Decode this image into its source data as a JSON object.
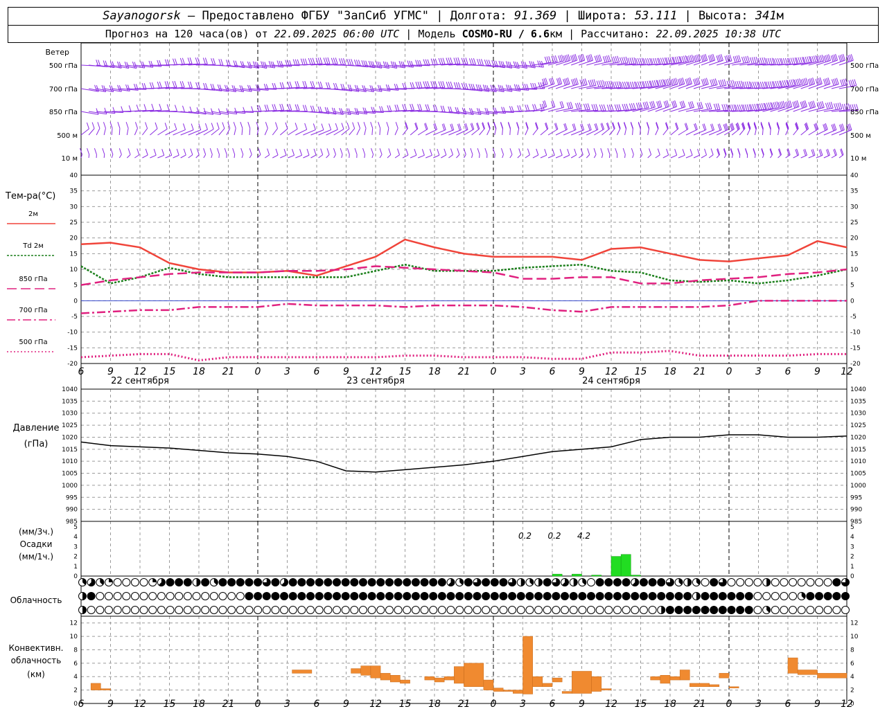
{
  "header": {
    "station": "Sayanogorsk",
    "provider": " – Предоставлено ФГБУ \"ЗапСиб УГМС\" | Долгота: ",
    "longitude": "91.369",
    "lat_label": " | Широта: ",
    "latitude": "53.111",
    "alt_label": " | Высота: ",
    "altitude": "341",
    "alt_unit": "м",
    "forecast_prefix": "Прогноз на 120 часа(ов) от ",
    "forecast_time": "22.09.2025 06:00 UTC",
    "model_prefix": "  | Модель ",
    "model": "COSMO-RU / 6.6",
    "model_unit": "км",
    "calc_prefix": " | Рассчитано: ",
    "calc_time": "22.09.2025 10:38 UTC"
  },
  "colors": {
    "wind": "#8a2be2",
    "t2m": "#f0443a",
    "td2m": "#1a7f1a",
    "t850": "#e0207f",
    "t700": "#e0207f",
    "t500": "#e0207f",
    "precip": "#22dd22",
    "conv": "#f08a30",
    "zero_line": "#3344cc"
  },
  "wind_panel": {
    "title": "Ветер",
    "levels": [
      "500 гПа",
      "700 гПа",
      "850 гПа",
      "500 м",
      "10 м"
    ]
  },
  "x_axis": {
    "tick_labels": [
      "6",
      "9",
      "12",
      "15",
      "18",
      "21",
      "0",
      "3",
      "6",
      "9",
      "12",
      "15",
      "18",
      "21",
      "0",
      "3",
      "6",
      "9",
      "12",
      "15",
      "18",
      "21",
      "0",
      "3",
      "6",
      "9",
      "12"
    ],
    "dates": [
      "22 сентября",
      "23 сентября",
      "24 сентября"
    ]
  },
  "temp_panel": {
    "title": "Тем-ра(°C)",
    "legend": [
      {
        "label": "2м",
        "style": "solid",
        "color_key": "t2m"
      },
      {
        "label": "Td 2м",
        "style": "dotted",
        "color_key": "td2m"
      },
      {
        "label": "850 гПа",
        "style": "longdash",
        "color_key": "t850"
      },
      {
        "label": "700 гПа",
        "style": "dashdot",
        "color_key": "t700"
      },
      {
        "label": "500 гПа",
        "style": "dot",
        "color_key": "t500"
      }
    ],
    "y_ticks": [
      "40",
      "35",
      "30",
      "25",
      "20",
      "15",
      "10",
      "5",
      "0",
      "-5",
      "-10",
      "-15",
      "-20"
    ]
  },
  "pressure_panel": {
    "title": "Давление",
    "unit": "(гПа)",
    "y_ticks": [
      "1040",
      "1035",
      "1030",
      "1025",
      "1020",
      "1015",
      "1010",
      "1005",
      "1000",
      "995",
      "990",
      "985"
    ]
  },
  "precip_panel": {
    "unit_3h": "(мм/3ч.)",
    "title": "Осадки",
    "unit_1h": "(мм/1ч.)",
    "y_ticks": [
      "5",
      "4",
      "3",
      "2",
      "1",
      "0"
    ],
    "totals": [
      "0.2",
      "0.2",
      "4.2"
    ]
  },
  "cloud_panel": {
    "title": "Облачность"
  },
  "conv_panel": {
    "title1": "Конвективн.",
    "title2": "облачность",
    "unit": "(км)",
    "y_ticks": [
      "12",
      "10",
      "8",
      "6",
      "4",
      "2",
      "0"
    ]
  },
  "chart_data": [
    {
      "type": "line",
      "panel": "temperature",
      "x_hours": [
        0,
        3,
        6,
        9,
        12,
        15,
        18,
        21,
        24,
        27,
        30,
        33,
        36,
        39,
        42,
        45,
        48,
        51,
        54,
        57,
        60,
        63,
        66,
        69,
        72,
        75,
        78
      ],
      "ylim": [
        -20,
        40
      ],
      "series": [
        {
          "name": "2м",
          "values": [
            18,
            18.5,
            17,
            12,
            10,
            9,
            9,
            9.5,
            8,
            11,
            14,
            19.5,
            17,
            15,
            14,
            14,
            14,
            13,
            16.5,
            17,
            15,
            13,
            12.5,
            13.5,
            14.5,
            19,
            17
          ]
        },
        {
          "name": "Td 2м",
          "values": [
            11,
            5.5,
            7.5,
            10.5,
            8.5,
            7.5,
            7.5,
            7.5,
            7.5,
            7.5,
            9.5,
            11.5,
            9.5,
            9.5,
            9.5,
            10.5,
            11,
            11.5,
            9.5,
            9,
            6.5,
            6,
            6.5,
            5.5,
            6.5,
            8,
            10
          ]
        },
        {
          "name": "850 гПа",
          "values": [
            5,
            6.5,
            7.5,
            8.5,
            9,
            9,
            9,
            9.5,
            9.5,
            10,
            11,
            10.5,
            10,
            9.5,
            9,
            7,
            7,
            7.5,
            7.5,
            5.5,
            5.5,
            6.5,
            7,
            7.5,
            8.5,
            9,
            10
          ]
        },
        {
          "name": "700 гПа",
          "values": [
            -4,
            -3.5,
            -3,
            -3,
            -2,
            -2,
            -2,
            -1,
            -1.5,
            -1.5,
            -1.5,
            -2,
            -1.5,
            -1.5,
            -1.5,
            -2,
            -3,
            -3.5,
            -2,
            -2,
            -2,
            -2,
            -1.5,
            0,
            0,
            0,
            0
          ]
        },
        {
          "name": "500 гПа",
          "values": [
            -18,
            -17.5,
            -17,
            -17,
            -19,
            -18,
            -18,
            -18,
            -18,
            -18,
            -18,
            -17.5,
            -17.5,
            -18,
            -18,
            -18,
            -18.5,
            -18.5,
            -16.5,
            -16.5,
            -16,
            -17.5,
            -17.5,
            -17.5,
            -17.5,
            -17,
            -17
          ]
        }
      ]
    },
    {
      "type": "line",
      "panel": "pressure",
      "ylabel": "(гПа)",
      "ylim": [
        985,
        1040
      ],
      "x_hours": [
        0,
        3,
        6,
        9,
        12,
        15,
        18,
        21,
        24,
        27,
        30,
        33,
        36,
        39,
        42,
        45,
        48,
        51,
        54,
        57,
        60,
        63,
        66,
        69,
        72,
        75,
        78
      ],
      "series": [
        {
          "name": "Давление",
          "values": [
            1018,
            1016.5,
            1016,
            1015.5,
            1014.5,
            1013.5,
            1013,
            1012,
            1010,
            1006,
            1005.5,
            1006.5,
            1007.5,
            1008.5,
            1010,
            1012,
            1014,
            1015,
            1016,
            1019,
            1020,
            1020,
            1021,
            1021,
            1020,
            1020,
            1020.5
          ]
        }
      ]
    },
    {
      "type": "bar",
      "panel": "precipitation",
      "ylim": [
        0,
        5
      ],
      "x_hours": [
        48,
        50,
        52,
        54,
        55,
        56
      ],
      "values": [
        0.2,
        0.2,
        0.1,
        2,
        2.2,
        0.1
      ]
    },
    {
      "type": "bar",
      "panel": "convective_cloud",
      "ylabel": "(км)",
      "ylim": [
        0,
        13
      ],
      "segments": [
        {
          "x": [
            1,
            2
          ],
          "bottom": 2,
          "top": 3
        },
        {
          "x": [
            2,
            3
          ],
          "bottom": 2,
          "top": 2.2
        },
        {
          "x": [
            21.5,
            23.5
          ],
          "bottom": 4.5,
          "top": 5
        },
        {
          "x": [
            27.5,
            28.5
          ],
          "bottom": 4.5,
          "top": 5.2
        },
        {
          "x": [
            28.5,
            29.5
          ],
          "bottom": 4.2,
          "top": 5.6
        },
        {
          "x": [
            29.5,
            30.5
          ],
          "bottom": 3.8,
          "top": 5.6
        },
        {
          "x": [
            30.5,
            31.5
          ],
          "bottom": 3.5,
          "top": 4.5
        },
        {
          "x": [
            31.5,
            32.5
          ],
          "bottom": 3.2,
          "top": 4.2
        },
        {
          "x": [
            32.5,
            33.5
          ],
          "bottom": 3.0,
          "top": 3.5
        },
        {
          "x": [
            35,
            36
          ],
          "bottom": 3.5,
          "top": 4
        },
        {
          "x": [
            36,
            37
          ],
          "bottom": 3.2,
          "top": 3.8
        },
        {
          "x": [
            37,
            38
          ],
          "bottom": 3.5,
          "top": 4.0
        },
        {
          "x": [
            38,
            39
          ],
          "bottom": 3.0,
          "top": 5.5
        },
        {
          "x": [
            39,
            41
          ],
          "bottom": 2.5,
          "top": 6.0
        },
        {
          "x": [
            41,
            42
          ],
          "bottom": 2.0,
          "top": 3.5
        },
        {
          "x": [
            42,
            43
          ],
          "bottom": 1.8,
          "top": 2.3
        },
        {
          "x": [
            43,
            44
          ],
          "bottom": 1.8,
          "top": 2.0
        },
        {
          "x": [
            44,
            45
          ],
          "bottom": 1.5,
          "top": 2.0
        },
        {
          "x": [
            45,
            46
          ],
          "bottom": 1.4,
          "top": 10
        },
        {
          "x": [
            46,
            47
          ],
          "bottom": 2.5,
          "top": 4
        },
        {
          "x": [
            47,
            48
          ],
          "bottom": 2.5,
          "top": 3.0
        },
        {
          "x": [
            48,
            49
          ],
          "bottom": 3.2,
          "top": 3.8
        },
        {
          "x": [
            49,
            50
          ],
          "bottom": 1.5,
          "top": 1.8
        },
        {
          "x": [
            50,
            52
          ],
          "bottom": 1.5,
          "top": 4.8
        },
        {
          "x": [
            52,
            53
          ],
          "bottom": 1.8,
          "top": 4
        },
        {
          "x": [
            53,
            54
          ],
          "bottom": 2.0,
          "top": 2.2
        },
        {
          "x": [
            58,
            59
          ],
          "bottom": 3.5,
          "top": 4.0
        },
        {
          "x": [
            59,
            60
          ],
          "bottom": 3.0,
          "top": 4.2
        },
        {
          "x": [
            60,
            61
          ],
          "bottom": 3.5,
          "top": 4.0
        },
        {
          "x": [
            61,
            62
          ],
          "bottom": 3.5,
          "top": 5.0
        },
        {
          "x": [
            62,
            64
          ],
          "bottom": 2.5,
          "top": 3.0
        },
        {
          "x": [
            64,
            65
          ],
          "bottom": 2.5,
          "top": 2.8
        },
        {
          "x": [
            65,
            66
          ],
          "bottom": 3.8,
          "top": 4.5
        },
        {
          "x": [
            66,
            67
          ],
          "bottom": 2.3,
          "top": 2.5
        },
        {
          "x": [
            72,
            73
          ],
          "bottom": 4.5,
          "top": 6.8
        },
        {
          "x": [
            73,
            75
          ],
          "bottom": 4.3,
          "top": 5.0
        },
        {
          "x": [
            75,
            78
          ],
          "bottom": 3.8,
          "top": 4.5
        }
      ]
    },
    {
      "type": "table",
      "panel": "cloudiness",
      "description_levels": [
        "верхний",
        "средний",
        "нижний"
      ],
      "rows_oktas_pattern": [
        [
          3,
          5,
          3,
          2,
          0,
          0,
          0,
          0,
          2,
          5,
          8,
          8,
          8,
          4,
          8,
          3,
          8,
          8,
          8,
          8,
          8,
          6,
          8,
          5,
          8,
          8,
          8,
          8,
          8,
          8,
          8,
          8,
          8,
          8,
          8,
          8,
          8,
          8,
          8,
          8,
          8,
          8,
          5,
          3,
          8,
          6,
          8,
          8,
          8,
          6,
          4,
          3,
          4,
          8,
          6,
          5,
          4,
          3,
          0,
          8,
          8,
          8,
          8,
          5,
          8,
          8,
          8,
          6,
          3,
          4,
          3,
          0,
          8,
          6,
          0,
          0,
          0,
          0,
          4,
          0,
          0,
          0,
          0,
          0,
          0,
          0,
          8,
          6,
          4,
          0,
          3,
          2,
          3,
          0,
          3,
          4,
          2,
          0,
          5,
          8,
          3,
          6,
          3,
          8,
          8,
          4,
          0,
          0,
          8,
          5,
          4,
          0,
          0,
          0,
          4,
          0,
          0,
          0,
          3,
          8,
          3,
          0,
          0,
          0,
          0,
          0,
          0,
          0,
          0,
          0,
          0,
          0,
          0,
          0,
          0,
          0,
          0,
          2,
          3,
          0,
          0,
          0,
          0,
          0,
          0,
          0,
          0,
          0,
          0,
          4,
          5
        ],
        [
          4,
          8,
          0,
          0,
          0,
          0,
          0,
          0,
          0,
          0,
          0,
          0,
          0,
          0,
          0,
          0,
          0,
          0,
          0,
          8,
          8,
          8,
          8,
          8,
          8,
          8,
          8,
          8,
          8,
          8,
          8,
          8,
          8,
          8,
          8,
          8,
          8,
          8,
          8,
          8,
          8,
          8,
          8,
          8,
          8,
          8,
          8,
          8,
          8,
          8,
          8,
          8,
          8,
          8,
          8,
          8,
          8,
          8,
          8,
          8,
          8,
          8,
          8,
          8,
          8,
          8,
          8,
          8,
          8,
          8,
          4,
          8,
          8,
          8,
          8,
          8,
          8,
          0,
          0,
          0,
          0,
          0,
          3,
          8,
          8,
          8,
          8,
          8,
          8,
          8,
          8,
          8,
          8,
          8,
          8,
          8,
          8,
          8,
          8,
          8,
          8,
          8,
          8,
          8,
          4,
          8,
          8,
          8,
          8,
          8,
          8,
          8,
          8,
          8,
          8,
          8,
          8,
          8,
          8,
          8,
          8,
          8,
          8,
          8,
          8,
          8,
          8,
          8,
          8,
          8,
          8,
          8,
          8,
          8,
          8,
          8,
          8,
          8,
          8,
          8,
          8,
          8,
          8,
          8,
          8,
          8,
          8,
          8,
          8,
          8,
          8,
          8,
          8,
          8,
          8,
          8,
          8,
          4
        ],
        [
          4,
          0,
          0,
          0,
          0,
          0,
          0,
          0,
          0,
          0,
          0,
          0,
          0,
          0,
          0,
          0,
          0,
          0,
          0,
          0,
          0,
          0,
          0,
          0,
          0,
          0,
          0,
          0,
          0,
          0,
          0,
          0,
          0,
          0,
          0,
          0,
          0,
          0,
          0,
          0,
          0,
          0,
          0,
          0,
          0,
          0,
          0,
          0,
          0,
          0,
          0,
          0,
          0,
          0,
          0,
          0,
          0,
          0,
          0,
          0,
          0,
          0,
          0,
          0,
          0,
          0,
          4,
          8,
          8,
          8,
          8,
          8,
          8,
          8,
          8,
          8,
          8,
          0,
          3,
          0,
          0,
          0,
          0,
          0,
          0,
          0,
          0,
          0,
          0,
          0,
          0,
          0,
          0,
          0,
          0,
          0,
          0,
          0,
          0,
          0,
          0,
          0,
          0,
          0,
          0,
          0,
          0,
          0,
          0,
          0,
          0,
          0,
          0,
          0,
          0,
          0,
          0,
          0,
          0,
          0,
          0,
          0,
          0,
          0,
          0,
          0,
          0,
          0,
          0,
          0,
          0,
          0,
          0,
          0,
          0,
          0,
          0,
          0,
          0,
          0,
          0,
          0,
          0,
          0,
          0,
          0,
          0,
          0,
          0,
          0,
          0,
          0
        ]
      ]
    }
  ]
}
